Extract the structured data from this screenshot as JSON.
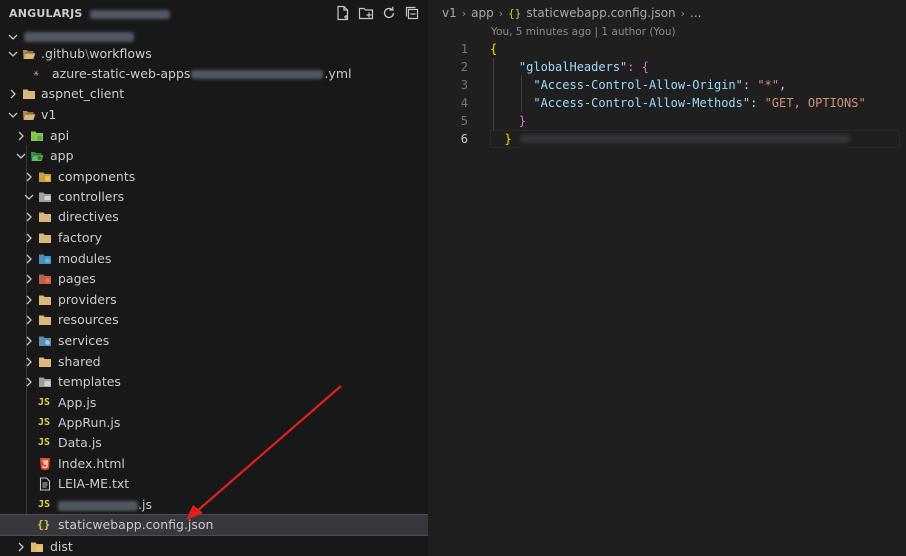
{
  "explorer": {
    "title": "ANGULARJS",
    "actions": [
      {
        "icon": "new-file-icon"
      },
      {
        "icon": "new-folder-icon"
      },
      {
        "icon": "refresh-icon"
      },
      {
        "icon": "collapse-all-icon"
      }
    ],
    "tree": [
      {
        "label": ".github",
        "label_extra": "workflows",
        "type": "folder",
        "open": true
      },
      {
        "label": "azure-static-web-apps",
        "label_extra": ".yml",
        "type": "yml"
      },
      {
        "label": "aspnet_client",
        "type": "folder",
        "open": false
      },
      {
        "label": "v1",
        "type": "folder",
        "open": true
      },
      {
        "label": "api",
        "type": "folder",
        "open": false
      },
      {
        "label": "app",
        "type": "folder",
        "open": true
      },
      {
        "label": "components",
        "type": "folder",
        "open": false
      },
      {
        "label": "controllers",
        "type": "folder",
        "open": true
      },
      {
        "label": "directives",
        "type": "folder",
        "open": false
      },
      {
        "label": "factory",
        "type": "folder",
        "open": false
      },
      {
        "label": "modules",
        "type": "folder",
        "open": false
      },
      {
        "label": "pages",
        "type": "folder",
        "open": false
      },
      {
        "label": "providers",
        "type": "folder",
        "open": false
      },
      {
        "label": "resources",
        "type": "folder",
        "open": false
      },
      {
        "label": "services",
        "type": "folder",
        "open": false
      },
      {
        "label": "shared",
        "type": "folder",
        "open": false
      },
      {
        "label": "templates",
        "type": "folder",
        "open": false
      },
      {
        "label": "App.js",
        "type": "js"
      },
      {
        "label": "AppRun.js",
        "type": "js"
      },
      {
        "label": "Data.js",
        "type": "js"
      },
      {
        "label": "Index.html",
        "type": "html"
      },
      {
        "label": "LEIA-ME.txt",
        "type": "txt"
      },
      {
        "label": ".js",
        "type": "js"
      },
      {
        "label": "staticwebapp.config.json",
        "type": "json",
        "selected": true
      },
      {
        "label": "dist",
        "type": "folder",
        "open": false
      }
    ],
    "folder_marker": "\\"
  },
  "editor": {
    "breadcrumb": [
      "v1",
      "app",
      "staticwebapp.config.json",
      "..."
    ],
    "blame": "You, 5 minutes ago | 1 author (You)",
    "line_numbers": [
      "1",
      "2",
      "3",
      "4",
      "5",
      "6"
    ],
    "active_line": "6",
    "code": {
      "l1": "{",
      "l2_key": "\"globalHeaders\"",
      "l2_rest": ": {",
      "l3_key": "\"Access-Control-Allow-Origin\"",
      "l3_colon": ": ",
      "l3_val": "\"*\"",
      "l3_end": ",",
      "l4_key": "\"Access-Control-Allow-Methods\"",
      "l4_colon": ": ",
      "l4_val": "\"GET, OPTIONS\"",
      "l5": "}",
      "l6": "}"
    }
  },
  "colors": {
    "sidebar_bg": "#181818",
    "editor_bg": "#1f1f1f",
    "selection": "#37373d",
    "arrow": "#e0201b"
  }
}
